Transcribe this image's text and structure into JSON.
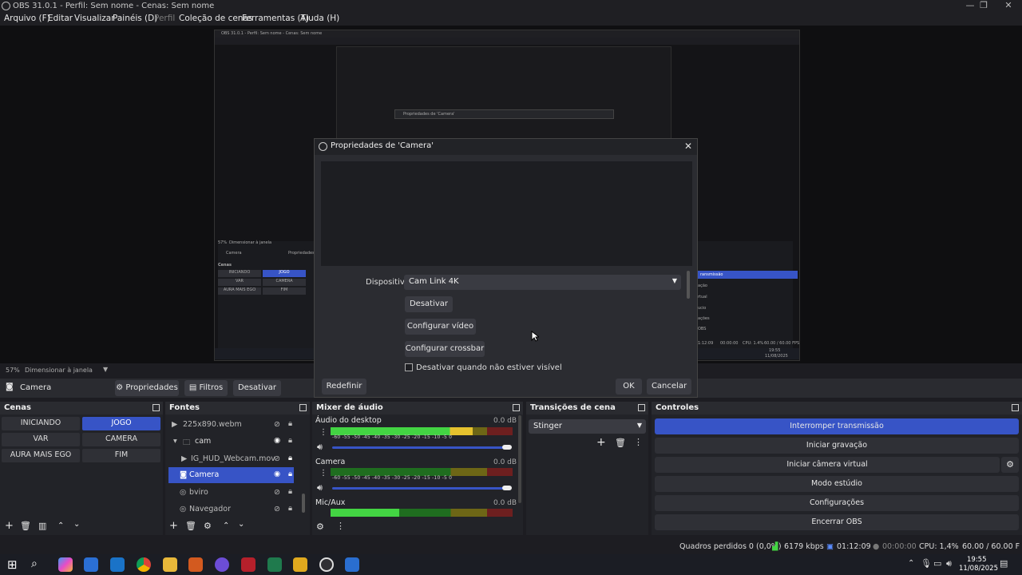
{
  "window": {
    "title": "OBS 31.0.1 - Perfil: Sem nome - Cenas: Sem nome"
  },
  "menu": [
    {
      "label": "Arquivo (F)",
      "disabled": false
    },
    {
      "label": "Editar",
      "disabled": false
    },
    {
      "label": "Visualizar",
      "disabled": false
    },
    {
      "label": "Painéis (D)",
      "disabled": false
    },
    {
      "label": "Perfil",
      "disabled": true
    },
    {
      "label": "Coleção de cenas",
      "disabled": false
    },
    {
      "label": "Ferramentas (T)",
      "disabled": false
    },
    {
      "label": "Ajuda (H)",
      "disabled": false
    }
  ],
  "preview_nested": {
    "title": "OBS 31.0.1 - Perfil: Sem nome - Cenas: Sem nome",
    "dialog_title": "Propriedades de 'Camera'",
    "zoom": "57%",
    "zoom_mode": "Dimensionar à janela",
    "source": "Camera",
    "props_btn": "Propriedades",
    "scenes_title": "Cenas",
    "scenes": [
      "INICIANDO",
      "JOGO",
      "VAR",
      "CAMERA",
      "AURA MAIS EGO",
      "FIM"
    ],
    "right_items": [
      "ransmissão",
      "ação",
      "rtual",
      "ucio",
      "ações",
      "OBS"
    ],
    "clock": "19:55",
    "date": "11/08/2025",
    "cpu": "CPU: 1.4%",
    "fps": "60.00 / 60.00 FPS",
    "time": "1:12:09",
    "rec": "00:00:00"
  },
  "zoombar": {
    "percent": "57%",
    "mode": "Dimensionar à janela"
  },
  "context": {
    "source": "Camera",
    "properties": "Propriedades",
    "filters": "Filtros",
    "deactivate": "Desativar"
  },
  "dialog": {
    "title": "Propriedades de 'Camera'",
    "device_label": "Dispositivo",
    "device_value": "Cam Link 4K",
    "btn_deactivate": "Desativar",
    "btn_config_video": "Configurar vídeo",
    "btn_config_crossbar": "Configurar crossbar",
    "checkbox_label": "Desativar quando não estiver visível",
    "checkbox_checked": false,
    "btn_reset": "Redefinir",
    "btn_ok": "OK",
    "btn_cancel": "Cancelar"
  },
  "scenes": {
    "title": "Cenas",
    "items": [
      {
        "label": "INICIANDO",
        "selected": false
      },
      {
        "label": "JOGO",
        "selected": true
      },
      {
        "label": "VAR",
        "selected": false
      },
      {
        "label": "CAMERA",
        "selected": false
      },
      {
        "label": "AURA MAIS EGO",
        "selected": false
      },
      {
        "label": "FIM",
        "selected": false
      }
    ]
  },
  "sources": {
    "title": "Fontes",
    "items": [
      {
        "label": "225x890.webm",
        "icon": "play-icon",
        "visible": false,
        "selected": false
      },
      {
        "label": "cam",
        "icon": "folder-icon",
        "visible": true,
        "selected": false
      },
      {
        "label": "IG_HUD_Webcam.mov",
        "icon": "play-icon",
        "visible": false,
        "selected": false
      },
      {
        "label": "Camera",
        "icon": "camera-icon",
        "visible": true,
        "selected": true
      },
      {
        "label": "bviro",
        "icon": "globe-icon",
        "visible": false,
        "selected": false
      },
      {
        "label": "Navegador",
        "icon": "globe-icon",
        "visible": false,
        "selected": false
      }
    ]
  },
  "mixer": {
    "title": "Mixer de áudio",
    "ticks": "-60  -55  -50  -45  -40  -35  -30  -25  -20  -15  -10   -5    0",
    "channels": [
      {
        "name": "Áudio do desktop",
        "db": "0.0 dB",
        "level": 0.78
      },
      {
        "name": "Camera",
        "db": "0.0 dB",
        "level": 0
      },
      {
        "name": "Mic/Aux",
        "db": "0.0 dB",
        "level": 0.38
      }
    ]
  },
  "transitions": {
    "title": "Transições de cena",
    "current": "Stinger"
  },
  "controls": {
    "title": "Controles",
    "buttons": [
      {
        "label": "Interromper transmissão",
        "active": true
      },
      {
        "label": "Iniciar gravação",
        "active": false
      },
      {
        "label": "Iniciar câmera virtual",
        "active": false
      },
      {
        "label": "Modo estúdio",
        "active": false
      },
      {
        "label": "Configurações",
        "active": false
      },
      {
        "label": "Encerrar OBS",
        "active": false
      }
    ]
  },
  "status": {
    "dropped": "Quadros perdidos 0 (0,0%)",
    "bitrate": "6179 kbps",
    "stream_time": "01:12:09",
    "rec_time": "00:00:00",
    "cpu": "CPU: 1,4%",
    "fps": "60.00 / 60.00 FPS"
  },
  "taskbar": {
    "time": "19:55",
    "date": "11/08/2025"
  }
}
